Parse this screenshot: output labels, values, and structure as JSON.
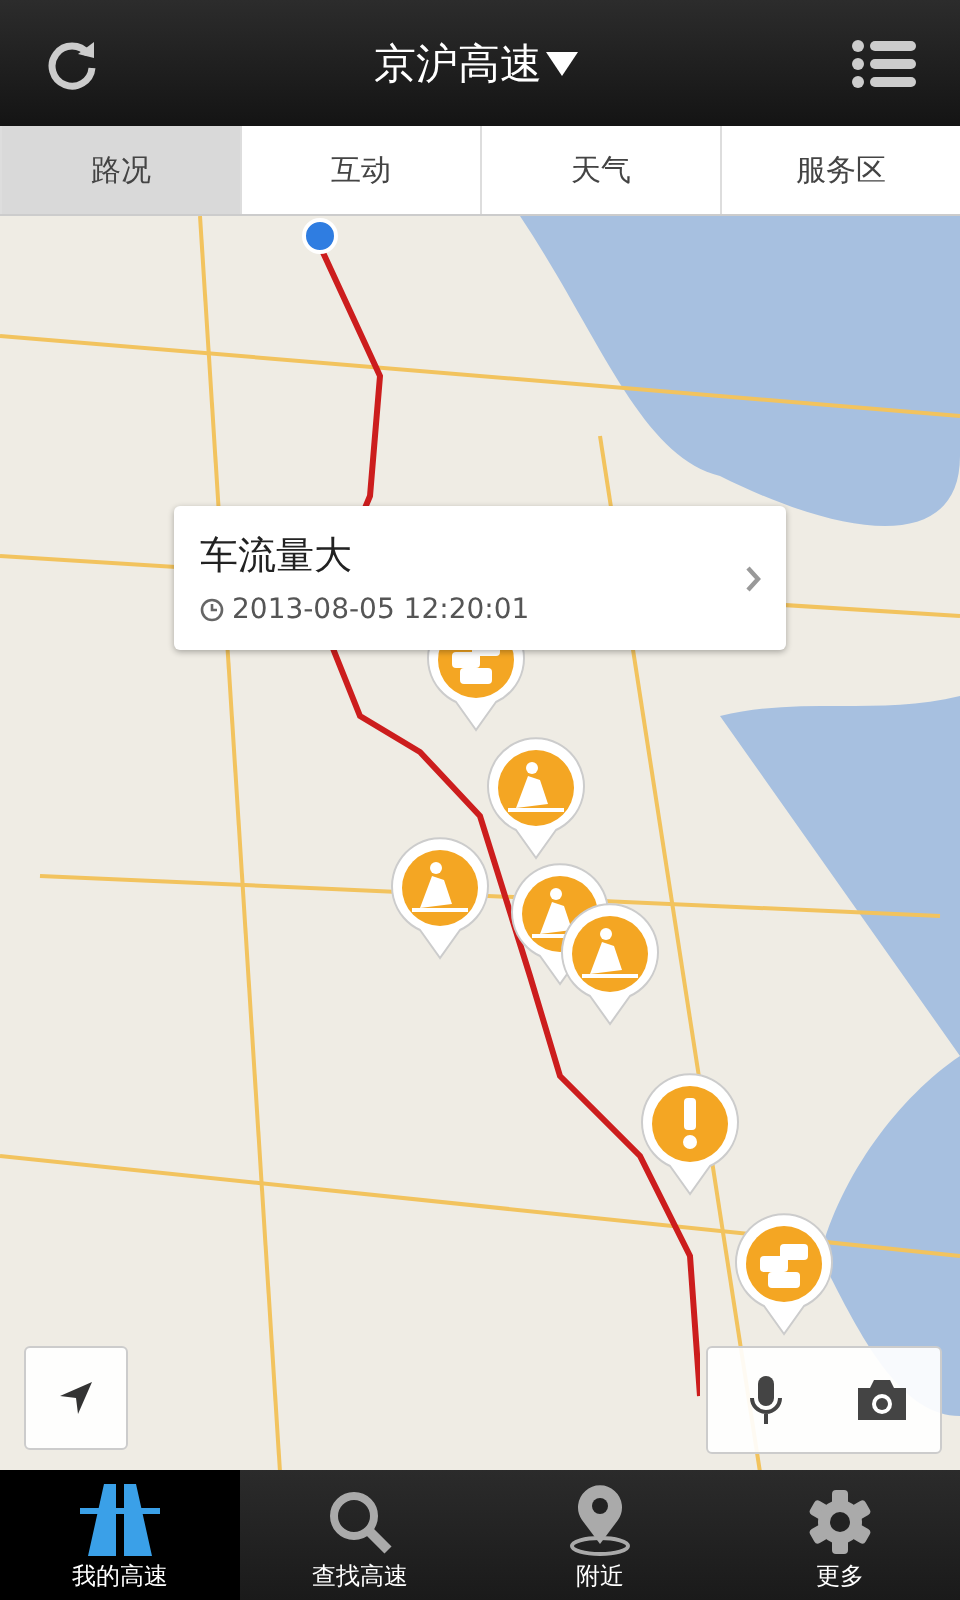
{
  "header": {
    "title": "京沪高速"
  },
  "tabs": [
    {
      "label": "路况",
      "selected": true
    },
    {
      "label": "互动",
      "selected": false
    },
    {
      "label": "天气",
      "selected": false
    },
    {
      "label": "服务区",
      "selected": false
    }
  ],
  "popup": {
    "title": "车流量大",
    "time": "2013-08-05 12:20:01"
  },
  "pins": [
    {
      "kind": "congestion"
    },
    {
      "kind": "roadwork"
    },
    {
      "kind": "roadwork"
    },
    {
      "kind": "roadwork"
    },
    {
      "kind": "roadwork"
    },
    {
      "kind": "warning"
    },
    {
      "kind": "congestion"
    }
  ],
  "nav": [
    {
      "kind": "highway",
      "label": "我的高速",
      "selected": true
    },
    {
      "kind": "search",
      "label": "查找高速",
      "selected": false
    },
    {
      "kind": "pin",
      "label": "附近",
      "selected": false
    },
    {
      "kind": "gear",
      "label": "更多",
      "selected": false
    }
  ]
}
